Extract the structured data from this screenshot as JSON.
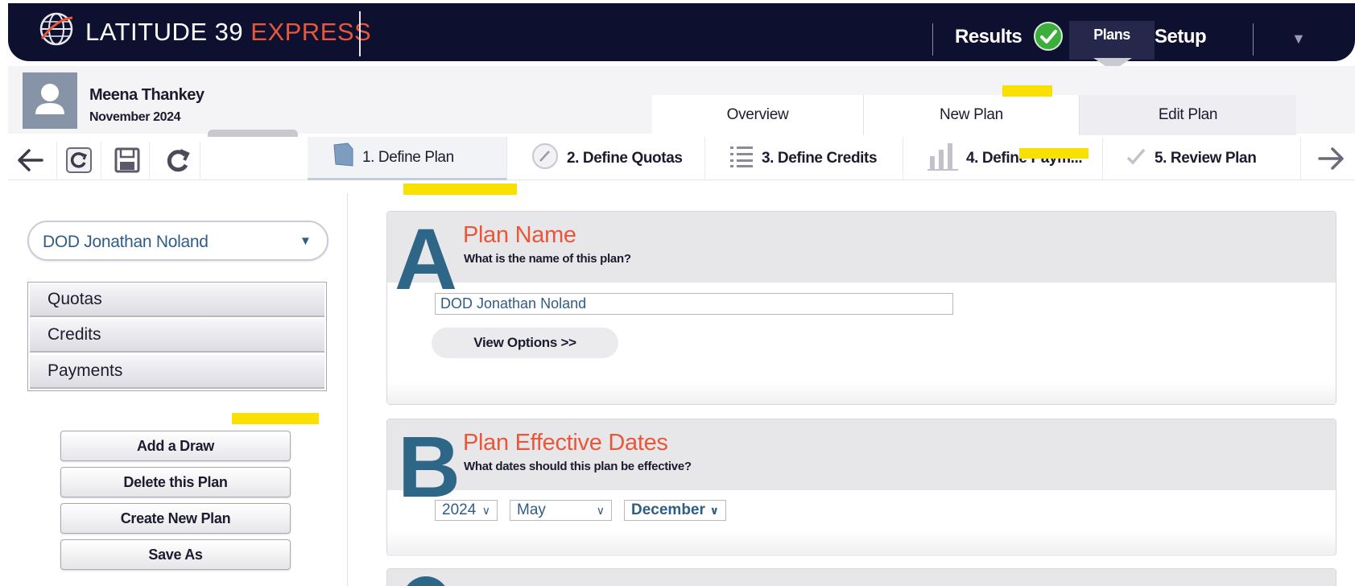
{
  "header": {
    "brand": "LATITUDE 39",
    "brand_accent": "EXPRESS",
    "nav": {
      "results": "Results",
      "plans": "Plans",
      "setup": "Setup",
      "more": "▼"
    }
  },
  "user": {
    "name": "Meena Thankey",
    "date": "November 2024"
  },
  "subtabs": {
    "overview": "Overview",
    "new_plan": "New Plan",
    "edit_plan": "Edit Plan"
  },
  "steps": [
    {
      "label": "1. Define Plan"
    },
    {
      "label": "2. Define Quotas"
    },
    {
      "label": "3. Define Credits"
    },
    {
      "label": "4. Define Paym..."
    },
    {
      "label": "5. Review Plan"
    }
  ],
  "sidebar": {
    "plan_select": "DOD Jonathan Noland",
    "items": [
      "Quotas",
      "Credits",
      "Payments"
    ],
    "buttons": {
      "add_draw": "Add a Draw",
      "delete_plan": "Delete this Plan",
      "create_plan": "Create New Plan",
      "save_as": "Save As"
    }
  },
  "panel_a": {
    "letter": "A",
    "title": "Plan Name",
    "subtitle": "What is the name of this plan?",
    "name_value": "DOD Jonathan Noland",
    "view_options": "View Options >>"
  },
  "panel_b": {
    "letter": "B",
    "title": "Plan Effective Dates",
    "subtitle": "What dates should this plan be effective?",
    "year": "2024",
    "start_month": "May",
    "end_month": "December"
  },
  "colors": {
    "navy": "#0e1030",
    "accent": "#e8573a",
    "steel_blue": "#2d6687",
    "success": "#3cae3c",
    "highlight": "#f8e000"
  }
}
